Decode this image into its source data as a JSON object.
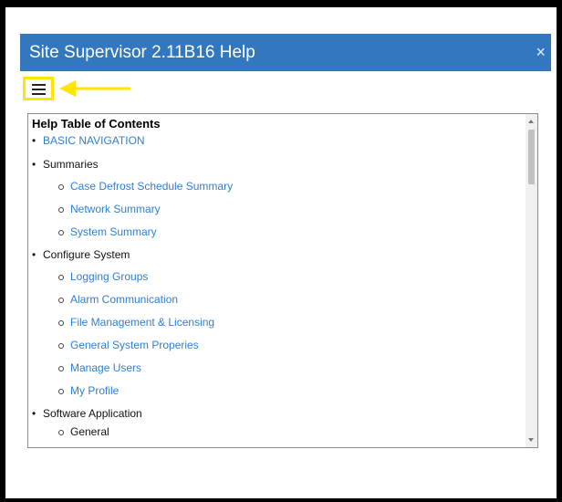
{
  "header": {
    "title": "Site Supervisor 2.11B16 Help",
    "close_glyph": "×"
  },
  "menu": {
    "icon": "hamburger-menu-icon",
    "highlight_color": "#ffe600"
  },
  "toc": {
    "heading": "Help Table of Contents",
    "link_color": "#2e7fd6",
    "items": [
      {
        "label": "BASIC NAVIGATION",
        "link": true,
        "children": []
      },
      {
        "label": "Summaries",
        "link": false,
        "children": [
          "Case Defrost Schedule Summary",
          "Network Summary",
          "System Summary"
        ]
      },
      {
        "label": "Configure System",
        "link": false,
        "children": [
          "Logging Groups",
          "Alarm Communication",
          "File Management & Licensing",
          "General System Properies",
          "Manage Users",
          "My Profile"
        ]
      },
      {
        "label": "Software Application",
        "link": false,
        "children": [
          "General"
        ]
      }
    ]
  },
  "colors": {
    "header_bg": "#3377be",
    "frame_bg": "#000000",
    "arrow": "#ffe600"
  }
}
